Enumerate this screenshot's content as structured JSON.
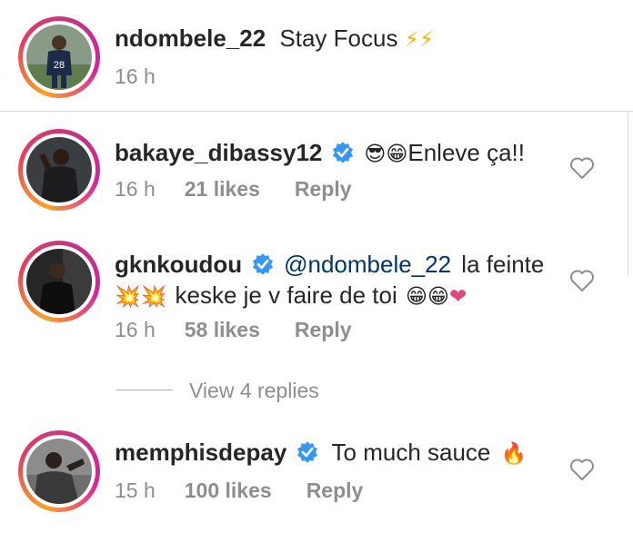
{
  "caption": {
    "username": "ndombele_22",
    "text": "Stay Focus",
    "emoji": "⚡⚡",
    "time": "16 h"
  },
  "comments": [
    {
      "username": "bakaye_dibassy12",
      "verified": true,
      "emoji": "😎😁",
      "text": "Enleve ça!!",
      "time": "16 h",
      "likes": "21 likes",
      "reply": "Reply"
    },
    {
      "username": "gknkoudou",
      "verified": true,
      "mention": "@ndombele_22",
      "text": "la feinte",
      "line2_emoji_a": "💥💥",
      "line2_text": "keske je v faire de toi",
      "line2_emoji_b": "😁😁",
      "line2_heart": "❤",
      "time": "16 h",
      "likes": "58 likes",
      "reply": "Reply"
    },
    {
      "username": "memphisdepay",
      "verified": true,
      "text": "To much sauce",
      "emoji": "🔥",
      "time": "15 h",
      "likes": "100 likes",
      "reply": "Reply"
    }
  ],
  "view_replies": "View 4 replies",
  "icons": {
    "verified": "verified-badge-icon",
    "like": "heart-outline-icon"
  },
  "colors": {
    "verified_blue": "#3897f0",
    "mention": "#003569",
    "secondary_text": "#8e8e8e",
    "ring_start": "#f9a32a",
    "ring_end": "#c13584",
    "heart_pink": "#e0457b"
  }
}
